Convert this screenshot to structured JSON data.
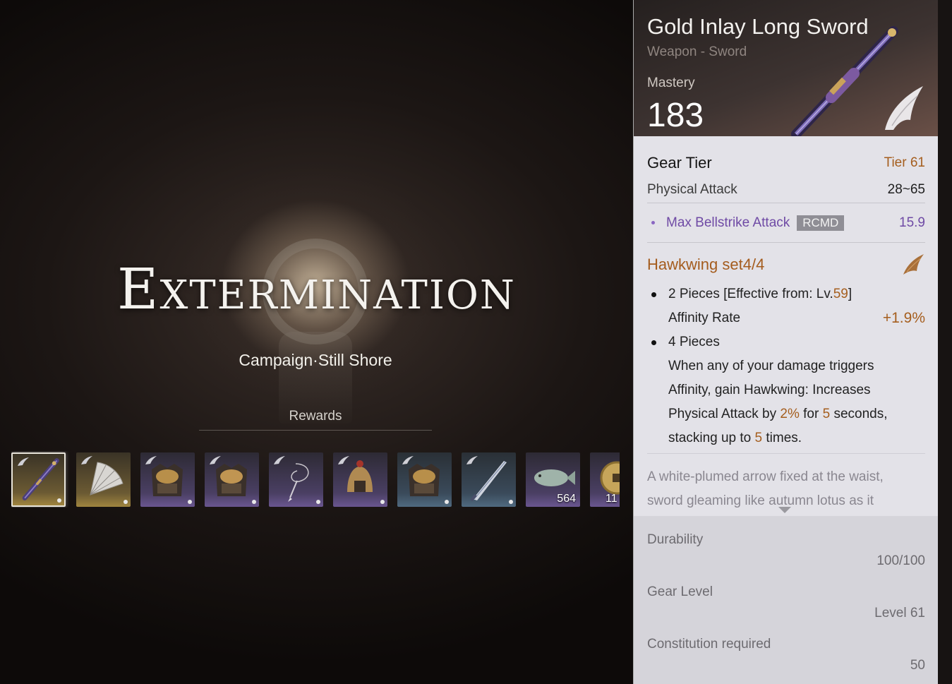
{
  "scene": {
    "title": "Extermination",
    "subtitle": "Campaign·Still Shore",
    "rewards_label": "Rewards"
  },
  "rewards": [
    {
      "icon": "long-sword-icon",
      "rarity": "gold",
      "selected": true,
      "count": ""
    },
    {
      "icon": "fan-icon",
      "rarity": "gold",
      "selected": false,
      "count": ""
    },
    {
      "icon": "chest-armor-icon",
      "rarity": "purple",
      "selected": false,
      "count": ""
    },
    {
      "icon": "chest-armor-icon",
      "rarity": "purple",
      "selected": false,
      "count": ""
    },
    {
      "icon": "rope-dart-icon",
      "rarity": "purple",
      "selected": false,
      "count": ""
    },
    {
      "icon": "helmet-icon",
      "rarity": "purple",
      "selected": false,
      "count": ""
    },
    {
      "icon": "chest-armor-icon",
      "rarity": "blue",
      "selected": false,
      "count": ""
    },
    {
      "icon": "blade-icon",
      "rarity": "blue",
      "selected": false,
      "count": ""
    },
    {
      "icon": "fish-icon",
      "rarity": "purple",
      "selected": false,
      "count": "564"
    },
    {
      "icon": "coin-icon",
      "rarity": "purple",
      "selected": false,
      "count": "11"
    }
  ],
  "item": {
    "name": "Gold Inlay Long Sword",
    "type": "Weapon - Sword",
    "mastery_label": "Mastery",
    "mastery_value": "183",
    "gear_tier_label": "Gear Tier",
    "gear_tier_value": "Tier 61",
    "physical_attack_label": "Physical Attack",
    "physical_attack_value": "28~65",
    "bonus_label": "Max Bellstrike Attack",
    "bonus_badge": "RCMD",
    "bonus_value": "15.9",
    "set_name": "Hawkwing set4/4",
    "set_2_prefix": "2 Pieces [Effective from: Lv.",
    "set_2_level": "59",
    "set_2_suffix": "]",
    "set_2_stat_label": "Affinity Rate",
    "set_2_stat_value": "+1.9%",
    "set_4_title": "4 Pieces",
    "set_4_line1": "When any of your damage triggers",
    "set_4_line2": "Affinity, gain Hawkwing: Increases",
    "set_4_line3a": "Physical Attack by ",
    "set_4_pct": "2%",
    "set_4_line3b": " for ",
    "set_4_secs": "5",
    "set_4_line3c": " seconds,",
    "set_4_line4a": "stacking up to ",
    "set_4_stacks": "5",
    "set_4_line4b": " times.",
    "lore_line1": "A white-plumed arrow fixed at the waist,",
    "lore_line2": "sword gleaming like autumn lotus as it",
    "durability_label": "Durability",
    "durability_value": "100/100",
    "gear_level_label": "Gear Level",
    "gear_level_value": "Level 61",
    "constitution_label": "Constitution required",
    "constitution_value": "50"
  },
  "colors": {
    "accent_orange": "#a55e1e",
    "accent_purple": "#6f4aa5",
    "panel_bg": "#e3e2e8"
  }
}
